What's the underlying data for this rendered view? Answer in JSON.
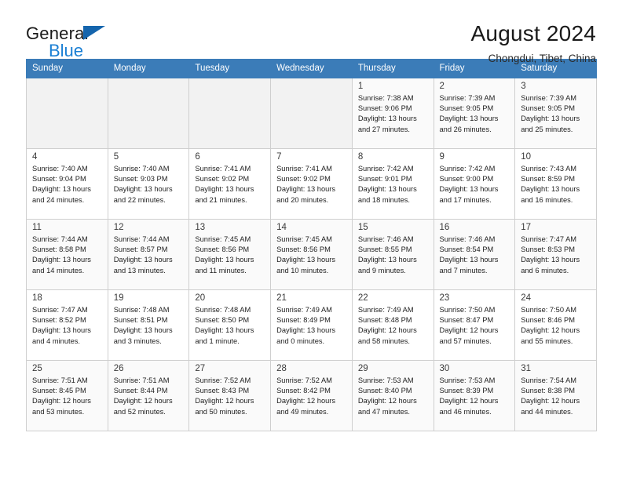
{
  "brand": {
    "name_part1": "General",
    "name_part2": "Blue",
    "triangle_icon": "blue-triangle-icon",
    "accent_color": "#1a7fd4",
    "logo_dark_color": "#1a1a1a"
  },
  "header": {
    "title": "August 2024",
    "subtitle": "Chongdui, Tibet, China"
  },
  "theme": {
    "header_row_bg": "#3b7cb8",
    "header_row_text": "#ffffff",
    "grid_border": "#cfcfcf",
    "empty_cell_bg": "#f2f2f2",
    "alt_row_bg": "#fafafa"
  },
  "weekday_headers": [
    "Sunday",
    "Monday",
    "Tuesday",
    "Wednesday",
    "Thursday",
    "Friday",
    "Saturday"
  ],
  "labels": {
    "sunrise_prefix": "Sunrise:",
    "sunset_prefix": "Sunset:",
    "daylight_prefix": "Daylight:"
  },
  "weeks": [
    [
      {
        "empty": true
      },
      {
        "empty": true
      },
      {
        "empty": true
      },
      {
        "empty": true
      },
      {
        "day": "1",
        "sunrise": "Sunrise: 7:38 AM",
        "sunset": "Sunset: 9:06 PM",
        "daylight_line1": "Daylight: 13 hours",
        "daylight_line2": "and 27 minutes."
      },
      {
        "day": "2",
        "sunrise": "Sunrise: 7:39 AM",
        "sunset": "Sunset: 9:05 PM",
        "daylight_line1": "Daylight: 13 hours",
        "daylight_line2": "and 26 minutes."
      },
      {
        "day": "3",
        "sunrise": "Sunrise: 7:39 AM",
        "sunset": "Sunset: 9:05 PM",
        "daylight_line1": "Daylight: 13 hours",
        "daylight_line2": "and 25 minutes."
      }
    ],
    [
      {
        "day": "4",
        "sunrise": "Sunrise: 7:40 AM",
        "sunset": "Sunset: 9:04 PM",
        "daylight_line1": "Daylight: 13 hours",
        "daylight_line2": "and 24 minutes."
      },
      {
        "day": "5",
        "sunrise": "Sunrise: 7:40 AM",
        "sunset": "Sunset: 9:03 PM",
        "daylight_line1": "Daylight: 13 hours",
        "daylight_line2": "and 22 minutes."
      },
      {
        "day": "6",
        "sunrise": "Sunrise: 7:41 AM",
        "sunset": "Sunset: 9:02 PM",
        "daylight_line1": "Daylight: 13 hours",
        "daylight_line2": "and 21 minutes."
      },
      {
        "day": "7",
        "sunrise": "Sunrise: 7:41 AM",
        "sunset": "Sunset: 9:02 PM",
        "daylight_line1": "Daylight: 13 hours",
        "daylight_line2": "and 20 minutes."
      },
      {
        "day": "8",
        "sunrise": "Sunrise: 7:42 AM",
        "sunset": "Sunset: 9:01 PM",
        "daylight_line1": "Daylight: 13 hours",
        "daylight_line2": "and 18 minutes."
      },
      {
        "day": "9",
        "sunrise": "Sunrise: 7:42 AM",
        "sunset": "Sunset: 9:00 PM",
        "daylight_line1": "Daylight: 13 hours",
        "daylight_line2": "and 17 minutes."
      },
      {
        "day": "10",
        "sunrise": "Sunrise: 7:43 AM",
        "sunset": "Sunset: 8:59 PM",
        "daylight_line1": "Daylight: 13 hours",
        "daylight_line2": "and 16 minutes."
      }
    ],
    [
      {
        "day": "11",
        "sunrise": "Sunrise: 7:44 AM",
        "sunset": "Sunset: 8:58 PM",
        "daylight_line1": "Daylight: 13 hours",
        "daylight_line2": "and 14 minutes."
      },
      {
        "day": "12",
        "sunrise": "Sunrise: 7:44 AM",
        "sunset": "Sunset: 8:57 PM",
        "daylight_line1": "Daylight: 13 hours",
        "daylight_line2": "and 13 minutes."
      },
      {
        "day": "13",
        "sunrise": "Sunrise: 7:45 AM",
        "sunset": "Sunset: 8:56 PM",
        "daylight_line1": "Daylight: 13 hours",
        "daylight_line2": "and 11 minutes."
      },
      {
        "day": "14",
        "sunrise": "Sunrise: 7:45 AM",
        "sunset": "Sunset: 8:56 PM",
        "daylight_line1": "Daylight: 13 hours",
        "daylight_line2": "and 10 minutes."
      },
      {
        "day": "15",
        "sunrise": "Sunrise: 7:46 AM",
        "sunset": "Sunset: 8:55 PM",
        "daylight_line1": "Daylight: 13 hours",
        "daylight_line2": "and 9 minutes."
      },
      {
        "day": "16",
        "sunrise": "Sunrise: 7:46 AM",
        "sunset": "Sunset: 8:54 PM",
        "daylight_line1": "Daylight: 13 hours",
        "daylight_line2": "and 7 minutes."
      },
      {
        "day": "17",
        "sunrise": "Sunrise: 7:47 AM",
        "sunset": "Sunset: 8:53 PM",
        "daylight_line1": "Daylight: 13 hours",
        "daylight_line2": "and 6 minutes."
      }
    ],
    [
      {
        "day": "18",
        "sunrise": "Sunrise: 7:47 AM",
        "sunset": "Sunset: 8:52 PM",
        "daylight_line1": "Daylight: 13 hours",
        "daylight_line2": "and 4 minutes."
      },
      {
        "day": "19",
        "sunrise": "Sunrise: 7:48 AM",
        "sunset": "Sunset: 8:51 PM",
        "daylight_line1": "Daylight: 13 hours",
        "daylight_line2": "and 3 minutes."
      },
      {
        "day": "20",
        "sunrise": "Sunrise: 7:48 AM",
        "sunset": "Sunset: 8:50 PM",
        "daylight_line1": "Daylight: 13 hours",
        "daylight_line2": "and 1 minute."
      },
      {
        "day": "21",
        "sunrise": "Sunrise: 7:49 AM",
        "sunset": "Sunset: 8:49 PM",
        "daylight_line1": "Daylight: 13 hours",
        "daylight_line2": "and 0 minutes."
      },
      {
        "day": "22",
        "sunrise": "Sunrise: 7:49 AM",
        "sunset": "Sunset: 8:48 PM",
        "daylight_line1": "Daylight: 12 hours",
        "daylight_line2": "and 58 minutes."
      },
      {
        "day": "23",
        "sunrise": "Sunrise: 7:50 AM",
        "sunset": "Sunset: 8:47 PM",
        "daylight_line1": "Daylight: 12 hours",
        "daylight_line2": "and 57 minutes."
      },
      {
        "day": "24",
        "sunrise": "Sunrise: 7:50 AM",
        "sunset": "Sunset: 8:46 PM",
        "daylight_line1": "Daylight: 12 hours",
        "daylight_line2": "and 55 minutes."
      }
    ],
    [
      {
        "day": "25",
        "sunrise": "Sunrise: 7:51 AM",
        "sunset": "Sunset: 8:45 PM",
        "daylight_line1": "Daylight: 12 hours",
        "daylight_line2": "and 53 minutes."
      },
      {
        "day": "26",
        "sunrise": "Sunrise: 7:51 AM",
        "sunset": "Sunset: 8:44 PM",
        "daylight_line1": "Daylight: 12 hours",
        "daylight_line2": "and 52 minutes."
      },
      {
        "day": "27",
        "sunrise": "Sunrise: 7:52 AM",
        "sunset": "Sunset: 8:43 PM",
        "daylight_line1": "Daylight: 12 hours",
        "daylight_line2": "and 50 minutes."
      },
      {
        "day": "28",
        "sunrise": "Sunrise: 7:52 AM",
        "sunset": "Sunset: 8:42 PM",
        "daylight_line1": "Daylight: 12 hours",
        "daylight_line2": "and 49 minutes."
      },
      {
        "day": "29",
        "sunrise": "Sunrise: 7:53 AM",
        "sunset": "Sunset: 8:40 PM",
        "daylight_line1": "Daylight: 12 hours",
        "daylight_line2": "and 47 minutes."
      },
      {
        "day": "30",
        "sunrise": "Sunrise: 7:53 AM",
        "sunset": "Sunset: 8:39 PM",
        "daylight_line1": "Daylight: 12 hours",
        "daylight_line2": "and 46 minutes."
      },
      {
        "day": "31",
        "sunrise": "Sunrise: 7:54 AM",
        "sunset": "Sunset: 8:38 PM",
        "daylight_line1": "Daylight: 12 hours",
        "daylight_line2": "and 44 minutes."
      }
    ]
  ]
}
